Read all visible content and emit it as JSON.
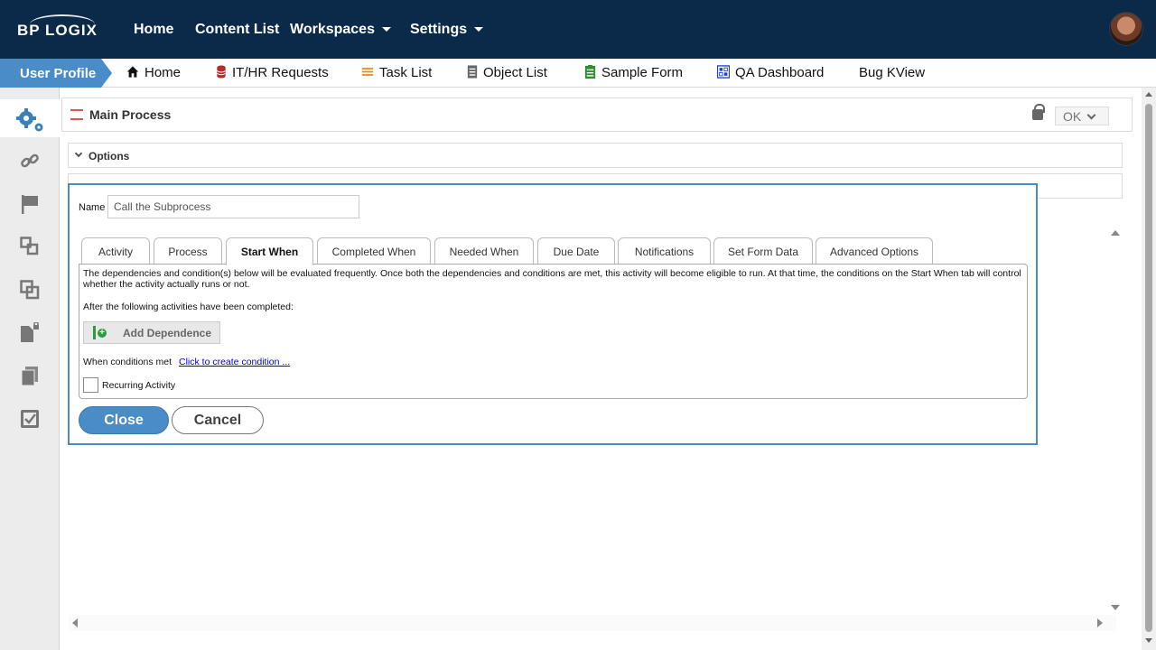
{
  "header": {
    "logo": "BP LOGIX",
    "nav": [
      {
        "label": "Home",
        "dropdown": false
      },
      {
        "label": "Content List",
        "dropdown": false
      },
      {
        "label": "Workspaces",
        "dropdown": true
      },
      {
        "label": "Settings",
        "dropdown": true
      }
    ]
  },
  "subnav": {
    "profile": "User Profile",
    "links": [
      {
        "label": "Home",
        "icon": "house-icon"
      },
      {
        "label": "IT/HR Requests",
        "icon": "database-icon"
      },
      {
        "label": "Task List",
        "icon": "list-icon"
      },
      {
        "label": "Object List",
        "icon": "document-icon"
      },
      {
        "label": "Sample Form",
        "icon": "form-icon"
      },
      {
        "label": "QA Dashboard",
        "icon": "dashboard-icon"
      },
      {
        "label": "Bug KView",
        "icon": ""
      }
    ]
  },
  "sidebar": {
    "icons": [
      "gears-icon",
      "link-icon",
      "flag-icon",
      "subprocess-icon",
      "copy-icon",
      "locked-document-icon",
      "documents-icon",
      "checkbox-icon"
    ]
  },
  "panel": {
    "title": "Main Process",
    "ok_label": "OK",
    "options_label": "Options"
  },
  "dialog": {
    "name_label": "Name",
    "name_value": "Call the Subprocess",
    "tabs": [
      {
        "label": "Activity",
        "active": false
      },
      {
        "label": "Process",
        "active": false
      },
      {
        "label": "Start When",
        "active": true
      },
      {
        "label": "Completed When",
        "active": false
      },
      {
        "label": "Needed When",
        "active": false
      },
      {
        "label": "Due Date",
        "active": false
      },
      {
        "label": "Notifications",
        "active": false
      },
      {
        "label": "Set Form Data",
        "active": false
      },
      {
        "label": "Advanced Options",
        "active": false
      }
    ],
    "description": "The dependencies and condition(s) below will be evaluated frequently. Once both the dependencies and conditions are met, this activity will become eligible to run. At that time, the conditions on the Start When tab will control whether the activity actually runs or not.",
    "after_label": "After the following activities have been completed:",
    "add_dependence": "Add Dependence",
    "when_label": "When conditions met",
    "condition_link": "Click to create condition ...",
    "recurring_label": "Recurring Activity",
    "close_label": "Close",
    "cancel_label": "Cancel"
  },
  "colors": {
    "header_bg": "#0b2a4a",
    "accent": "#4a8cc7"
  }
}
